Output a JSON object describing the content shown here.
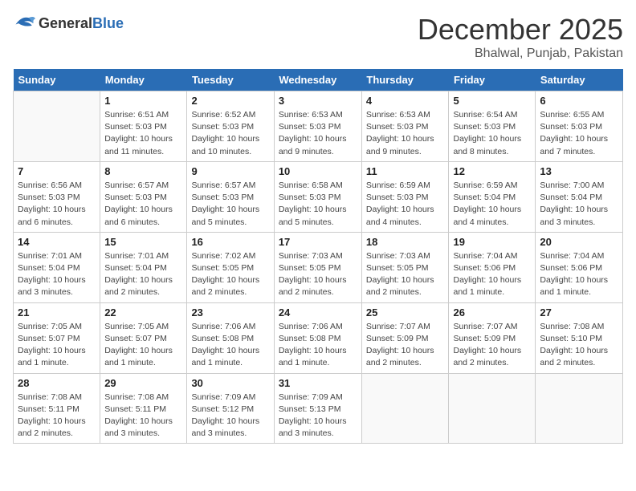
{
  "header": {
    "logo": {
      "general": "General",
      "blue": "Blue"
    },
    "title": "December 2025",
    "location": "Bhalwal, Punjab, Pakistan"
  },
  "days_of_week": [
    "Sunday",
    "Monday",
    "Tuesday",
    "Wednesday",
    "Thursday",
    "Friday",
    "Saturday"
  ],
  "weeks": [
    [
      {
        "day": "",
        "info": ""
      },
      {
        "day": "1",
        "info": "Sunrise: 6:51 AM\nSunset: 5:03 PM\nDaylight: 10 hours\nand 11 minutes."
      },
      {
        "day": "2",
        "info": "Sunrise: 6:52 AM\nSunset: 5:03 PM\nDaylight: 10 hours\nand 10 minutes."
      },
      {
        "day": "3",
        "info": "Sunrise: 6:53 AM\nSunset: 5:03 PM\nDaylight: 10 hours\nand 9 minutes."
      },
      {
        "day": "4",
        "info": "Sunrise: 6:53 AM\nSunset: 5:03 PM\nDaylight: 10 hours\nand 9 minutes."
      },
      {
        "day": "5",
        "info": "Sunrise: 6:54 AM\nSunset: 5:03 PM\nDaylight: 10 hours\nand 8 minutes."
      },
      {
        "day": "6",
        "info": "Sunrise: 6:55 AM\nSunset: 5:03 PM\nDaylight: 10 hours\nand 7 minutes."
      }
    ],
    [
      {
        "day": "7",
        "info": "Sunrise: 6:56 AM\nSunset: 5:03 PM\nDaylight: 10 hours\nand 6 minutes."
      },
      {
        "day": "8",
        "info": "Sunrise: 6:57 AM\nSunset: 5:03 PM\nDaylight: 10 hours\nand 6 minutes."
      },
      {
        "day": "9",
        "info": "Sunrise: 6:57 AM\nSunset: 5:03 PM\nDaylight: 10 hours\nand 5 minutes."
      },
      {
        "day": "10",
        "info": "Sunrise: 6:58 AM\nSunset: 5:03 PM\nDaylight: 10 hours\nand 5 minutes."
      },
      {
        "day": "11",
        "info": "Sunrise: 6:59 AM\nSunset: 5:03 PM\nDaylight: 10 hours\nand 4 minutes."
      },
      {
        "day": "12",
        "info": "Sunrise: 6:59 AM\nSunset: 5:04 PM\nDaylight: 10 hours\nand 4 minutes."
      },
      {
        "day": "13",
        "info": "Sunrise: 7:00 AM\nSunset: 5:04 PM\nDaylight: 10 hours\nand 3 minutes."
      }
    ],
    [
      {
        "day": "14",
        "info": "Sunrise: 7:01 AM\nSunset: 5:04 PM\nDaylight: 10 hours\nand 3 minutes."
      },
      {
        "day": "15",
        "info": "Sunrise: 7:01 AM\nSunset: 5:04 PM\nDaylight: 10 hours\nand 2 minutes."
      },
      {
        "day": "16",
        "info": "Sunrise: 7:02 AM\nSunset: 5:05 PM\nDaylight: 10 hours\nand 2 minutes."
      },
      {
        "day": "17",
        "info": "Sunrise: 7:03 AM\nSunset: 5:05 PM\nDaylight: 10 hours\nand 2 minutes."
      },
      {
        "day": "18",
        "info": "Sunrise: 7:03 AM\nSunset: 5:05 PM\nDaylight: 10 hours\nand 2 minutes."
      },
      {
        "day": "19",
        "info": "Sunrise: 7:04 AM\nSunset: 5:06 PM\nDaylight: 10 hours\nand 1 minute."
      },
      {
        "day": "20",
        "info": "Sunrise: 7:04 AM\nSunset: 5:06 PM\nDaylight: 10 hours\nand 1 minute."
      }
    ],
    [
      {
        "day": "21",
        "info": "Sunrise: 7:05 AM\nSunset: 5:07 PM\nDaylight: 10 hours\nand 1 minute."
      },
      {
        "day": "22",
        "info": "Sunrise: 7:05 AM\nSunset: 5:07 PM\nDaylight: 10 hours\nand 1 minute."
      },
      {
        "day": "23",
        "info": "Sunrise: 7:06 AM\nSunset: 5:08 PM\nDaylight: 10 hours\nand 1 minute."
      },
      {
        "day": "24",
        "info": "Sunrise: 7:06 AM\nSunset: 5:08 PM\nDaylight: 10 hours\nand 1 minute."
      },
      {
        "day": "25",
        "info": "Sunrise: 7:07 AM\nSunset: 5:09 PM\nDaylight: 10 hours\nand 2 minutes."
      },
      {
        "day": "26",
        "info": "Sunrise: 7:07 AM\nSunset: 5:09 PM\nDaylight: 10 hours\nand 2 minutes."
      },
      {
        "day": "27",
        "info": "Sunrise: 7:08 AM\nSunset: 5:10 PM\nDaylight: 10 hours\nand 2 minutes."
      }
    ],
    [
      {
        "day": "28",
        "info": "Sunrise: 7:08 AM\nSunset: 5:11 PM\nDaylight: 10 hours\nand 2 minutes."
      },
      {
        "day": "29",
        "info": "Sunrise: 7:08 AM\nSunset: 5:11 PM\nDaylight: 10 hours\nand 3 minutes."
      },
      {
        "day": "30",
        "info": "Sunrise: 7:09 AM\nSunset: 5:12 PM\nDaylight: 10 hours\nand 3 minutes."
      },
      {
        "day": "31",
        "info": "Sunrise: 7:09 AM\nSunset: 5:13 PM\nDaylight: 10 hours\nand 3 minutes."
      },
      {
        "day": "",
        "info": ""
      },
      {
        "day": "",
        "info": ""
      },
      {
        "day": "",
        "info": ""
      }
    ]
  ]
}
